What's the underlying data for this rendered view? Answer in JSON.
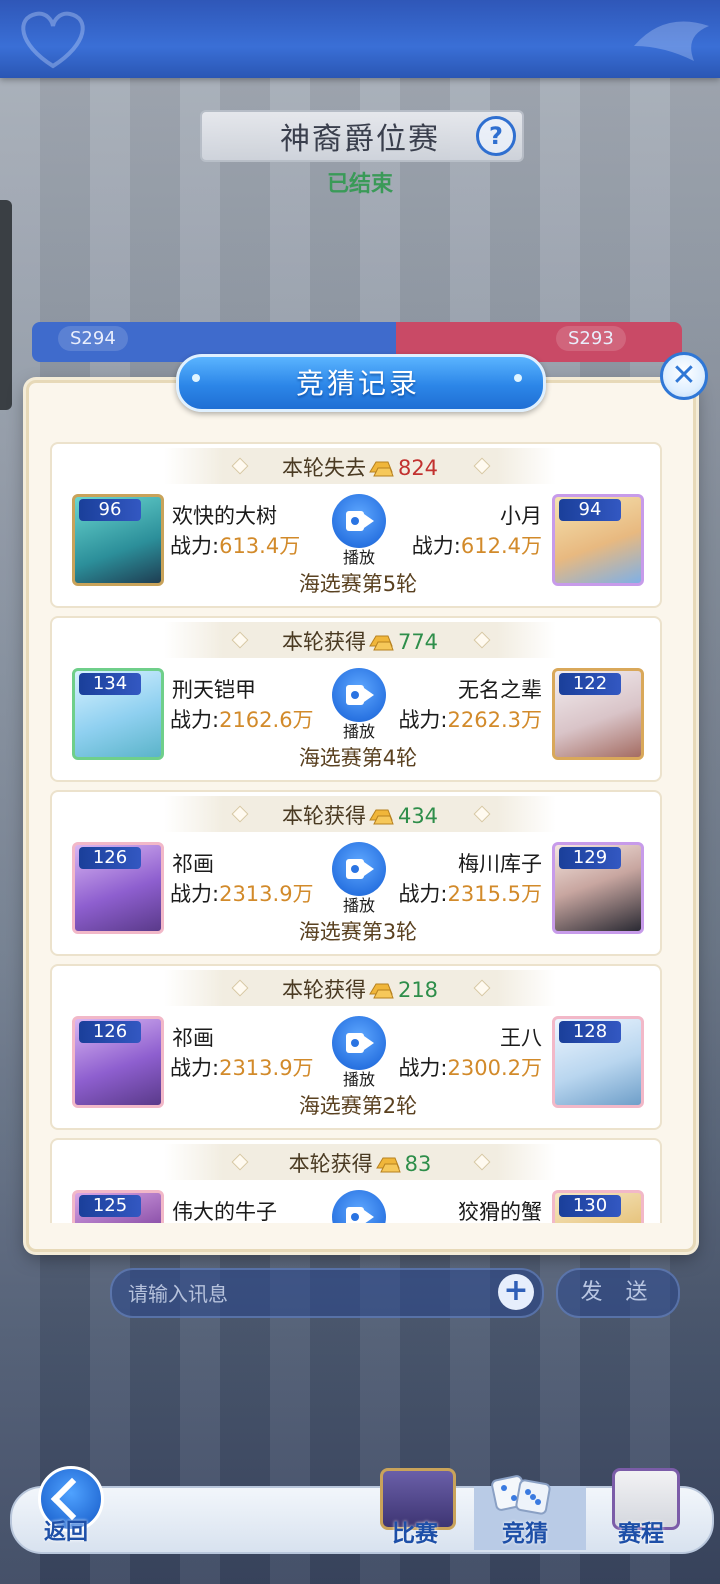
{
  "event": {
    "title": "神裔爵位赛",
    "status": "已结束",
    "help_icon": "question-mark-icon",
    "seasons": [
      "S294",
      "S293"
    ]
  },
  "modal": {
    "title": "竞猜记录",
    "close_icon": "close-icon"
  },
  "records": [
    {
      "result_label": "本轮失去",
      "amount": "824",
      "result_type": "loss",
      "left": {
        "level": "96",
        "name": "欢快的大树",
        "power_label": "战力:",
        "power": "613.4万"
      },
      "right": {
        "level": "94",
        "name": "小月",
        "power_label": "战力:",
        "power": "612.4万"
      },
      "play_label": "播放",
      "round": "海选赛第5轮"
    },
    {
      "result_label": "本轮获得",
      "amount": "774",
      "result_type": "gain",
      "left": {
        "level": "134",
        "name": "刑天铠甲",
        "power_label": "战力:",
        "power": "2162.6万"
      },
      "right": {
        "level": "122",
        "name": "无名之辈",
        "power_label": "战力:",
        "power": "2262.3万"
      },
      "play_label": "播放",
      "round": "海选赛第4轮"
    },
    {
      "result_label": "本轮获得",
      "amount": "434",
      "result_type": "gain",
      "left": {
        "level": "126",
        "name": "祁画",
        "power_label": "战力:",
        "power": "2313.9万"
      },
      "right": {
        "level": "129",
        "name": "梅川库子",
        "power_label": "战力:",
        "power": "2315.5万"
      },
      "play_label": "播放",
      "round": "海选赛第3轮"
    },
    {
      "result_label": "本轮获得",
      "amount": "218",
      "result_type": "gain",
      "left": {
        "level": "126",
        "name": "祁画",
        "power_label": "战力:",
        "power": "2313.9万"
      },
      "right": {
        "level": "128",
        "name": "王八",
        "power_label": "战力:",
        "power": "2300.2万"
      },
      "play_label": "播放",
      "round": "海选赛第2轮"
    },
    {
      "result_label": "本轮获得",
      "amount": "83",
      "result_type": "gain",
      "left": {
        "level": "125",
        "name": "伟大的牛子",
        "power_label": "",
        "power": ""
      },
      "right": {
        "level": "130",
        "name": "狡猾的蟹",
        "power_label": "",
        "power": ""
      },
      "play_label": "",
      "round": ""
    }
  ],
  "chat": {
    "placeholder": "请输入讯息",
    "plus_icon": "plus-icon",
    "send_label": "发 送"
  },
  "nav": {
    "back_label": "返回",
    "items": [
      {
        "label": "比赛",
        "icon": "match-icon"
      },
      {
        "label": "竞猜",
        "icon": "dice-icon",
        "active": true
      },
      {
        "label": "赛程",
        "icon": "calendar-icon"
      }
    ]
  },
  "colors": {
    "accent": "#2a74e2",
    "loss": "#c2312f",
    "gain": "#2e8e4a",
    "power": "#d28a2a"
  }
}
